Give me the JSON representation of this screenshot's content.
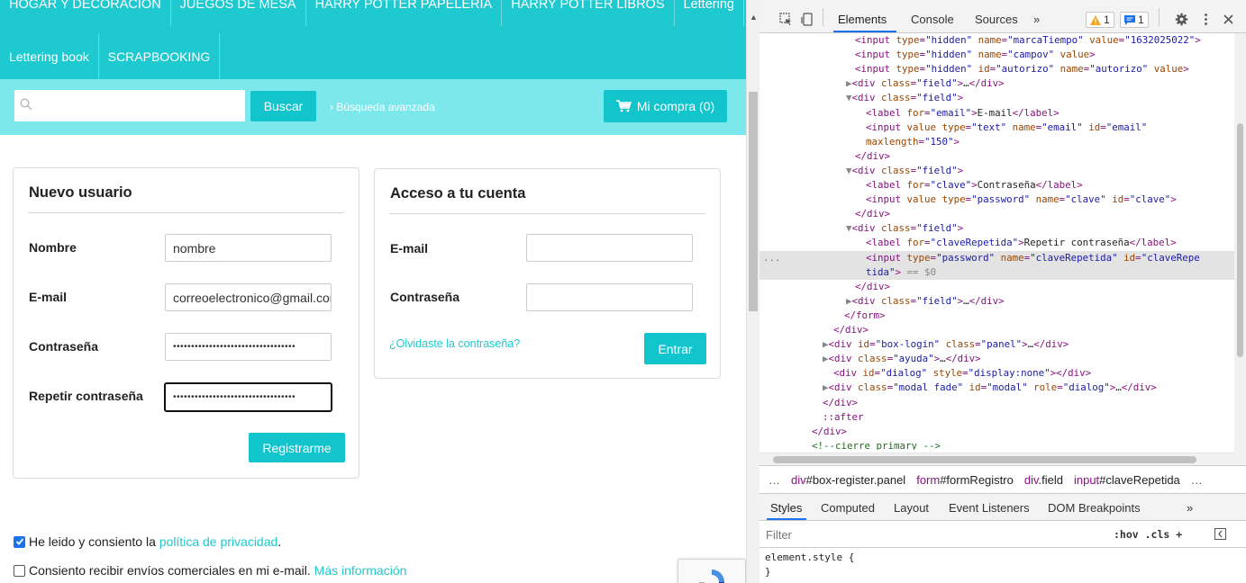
{
  "nav": {
    "row1": [
      "HOGAR Y DECORACIÓN",
      "JUEGOS DE MESA",
      "HARRY POTTER PAPELERÍA",
      "HARRY POTTER LIBROS",
      "Lettering"
    ],
    "row2": [
      "Lettering book",
      "SCRAPBOOKING"
    ]
  },
  "search": {
    "placeholder": "",
    "button_label": "Buscar",
    "advanced_link": "› Búsqueda avanzada",
    "cart_label": "Mi compra (0)"
  },
  "register": {
    "title": "Nuevo usuario",
    "fields": [
      {
        "label": "Nombre",
        "value": "nombre"
      },
      {
        "label": "E-mail",
        "value": "correoelectronico@gmail.com"
      },
      {
        "label": "Contraseña",
        "value": "••••••••••••••••••••••••••••••••••"
      },
      {
        "label": "Repetir contraseña",
        "value": "••••••••••••••••••••••••••••••••••"
      }
    ],
    "submit_label": "Registrarme"
  },
  "login": {
    "title": "Acceso a tu cuenta",
    "email_label": "E-mail",
    "password_label": "Contraseña",
    "forgot_link": "¿Olvidaste la contraseña?",
    "submit_label": "Entrar"
  },
  "consent": {
    "privacy_text": "He leido y consiento la ",
    "privacy_link": "política de privacidad",
    "privacy_suffix": ".",
    "privacy_checked": true,
    "commercial_text": "Consiento recibir envíos comerciales en mi e-mail. ",
    "commercial_link": "Más información",
    "commercial_checked": false
  },
  "devtools": {
    "tabs": [
      "Elements",
      "Console",
      "Sources",
      "»"
    ],
    "warnings_count": "1",
    "messages_count": "1",
    "dom_lines": [
      {
        "indent": 106,
        "html": "<span class='tg'>&lt;input</span> <span class='an'>type</span>=<span class='av'>\"hidden\"</span> <span class='an'>name</span>=<span class='av'>\"marcaTiempo\"</span> <span class='an'>value</span>=<span class='av'>\"1632025022\"</span><span class='tg'>&gt;</span>"
      },
      {
        "indent": 106,
        "html": "<span class='tg'>&lt;input</span> <span class='an'>type</span>=<span class='av'>\"hidden\"</span> <span class='an'>name</span>=<span class='av'>\"campov\"</span> <span class='an'>value</span><span class='tg'>&gt;</span>"
      },
      {
        "indent": 106,
        "html": "<span class='tg'>&lt;input</span> <span class='an'>type</span>=<span class='av'>\"hidden\"</span> <span class='an'>id</span>=<span class='av'>\"autorizo\"</span> <span class='an'>name</span>=<span class='av'>\"autorizo\"</span> <span class='an'>value</span><span class='tg'>&gt;</span>"
      },
      {
        "indent": 96,
        "html": "<span class='gray'>▶</span><span class='tg'>&lt;div</span> <span class='an'>class</span>=<span class='av'>\"field\"</span><span class='tg'>&gt;</span><span class='tx'>…</span><span class='tg'>&lt;/div&gt;</span>"
      },
      {
        "indent": 96,
        "html": "<span class='gray'>▼</span><span class='tg'>&lt;div</span> <span class='an'>class</span>=<span class='av'>\"field\"</span><span class='tg'>&gt;</span>"
      },
      {
        "indent": 118,
        "html": "<span class='tg'>&lt;label</span> <span class='an'>for</span>=<span class='av'>\"email\"</span><span class='tg'>&gt;</span><span class='tx'>E-mail</span><span class='tg'>&lt;/label&gt;</span>"
      },
      {
        "indent": 118,
        "html": "<span class='tg'>&lt;input</span> <span class='an'>value</span> <span class='an'>type</span>=<span class='av'>\"text\"</span> <span class='an'>name</span>=<span class='av'>\"email\"</span> <span class='an'>id</span>=<span class='av'>\"email\"</span>"
      },
      {
        "indent": 118,
        "html": "<span class='an'>maxlength</span>=<span class='av'>\"150\"</span><span class='tg'>&gt;</span>"
      },
      {
        "indent": 106,
        "html": "<span class='tg'>&lt;/div&gt;</span>"
      },
      {
        "indent": 96,
        "html": "<span class='gray'>▼</span><span class='tg'>&lt;div</span> <span class='an'>class</span>=<span class='av'>\"field\"</span><span class='tg'>&gt;</span>"
      },
      {
        "indent": 118,
        "html": "<span class='tg'>&lt;label</span> <span class='an'>for</span>=<span class='av'>\"clave\"</span><span class='tg'>&gt;</span><span class='tx'>Contraseña</span><span class='tg'>&lt;/label&gt;</span>"
      },
      {
        "indent": 118,
        "html": "<span class='tg'>&lt;input</span> <span class='an'>value</span> <span class='an'>type</span>=<span class='av'>\"password\"</span> <span class='an'>name</span>=<span class='av'>\"clave\"</span> <span class='an'>id</span>=<span class='av'>\"clave\"</span><span class='tg'>&gt;</span>"
      },
      {
        "indent": 106,
        "html": "<span class='tg'>&lt;/div&gt;</span>"
      },
      {
        "indent": 96,
        "html": "<span class='gray'>▼</span><span class='tg'>&lt;div</span> <span class='an'>class</span>=<span class='av'>\"field\"</span><span class='tg'>&gt;</span>"
      },
      {
        "indent": 118,
        "html": "<span class='tg'>&lt;label</span> <span class='an'>for</span>=<span class='av'>\"claveRepetida\"</span><span class='tg'>&gt;</span><span class='tx'>Repetir contraseña</span><span class='tg'>&lt;/label&gt;</span>"
      },
      {
        "indent": 118,
        "sel": true,
        "html": "<span class='tg'>&lt;input</span> <span class='an'>type</span>=<span class='av'>\"password\"</span> <span class='an'>name</span>=<span class='av'>\"claveRepetida\"</span> <span class='an'>id</span>=<span class='av'>\"claveRepe</span>"
      },
      {
        "indent": 118,
        "sel": true,
        "html": "<span class='av'>tida\"</span><span class='tg'>&gt;</span> <span class='gray'>== $0</span>"
      },
      {
        "indent": 106,
        "html": "<span class='tg'>&lt;/div&gt;</span>"
      },
      {
        "indent": 96,
        "html": "<span class='gray'>▶</span><span class='tg'>&lt;div</span> <span class='an'>class</span>=<span class='av'>\"field\"</span><span class='tg'>&gt;</span><span class='tx'>…</span><span class='tg'>&lt;/div&gt;</span>"
      },
      {
        "indent": 94,
        "html": "<span class='tg'>&lt;/form&gt;</span>"
      },
      {
        "indent": 82,
        "html": "<span class='tg'>&lt;/div&gt;</span>"
      },
      {
        "indent": 70,
        "html": "<span class='gray'>▶</span><span class='tg'>&lt;div</span> <span class='an'>id</span>=<span class='av'>\"box-login\"</span> <span class='an'>class</span>=<span class='av'>\"panel\"</span><span class='tg'>&gt;</span><span class='tx'>…</span><span class='tg'>&lt;/div&gt;</span>"
      },
      {
        "indent": 70,
        "html": "<span class='gray'>▶</span><span class='tg'>&lt;div</span> <span class='an'>class</span>=<span class='av'>\"ayuda\"</span><span class='tg'>&gt;</span><span class='tx'>…</span><span class='tg'>&lt;/div&gt;</span>"
      },
      {
        "indent": 82,
        "html": "<span class='tg'>&lt;div</span> <span class='an'>id</span>=<span class='av'>\"dialog\"</span> <span class='an'>style</span>=<span class='av'>\"display:none\"</span><span class='tg'>&gt;&lt;/div&gt;</span>"
      },
      {
        "indent": 70,
        "html": "<span class='gray'>▶</span><span class='tg'>&lt;div</span> <span class='an'>class</span>=<span class='av'>\"modal fade\"</span> <span class='an'>id</span>=<span class='av'>\"modal\"</span> <span class='an'>role</span>=<span class='av'>\"dialog\"</span><span class='tg'>&gt;</span><span class='tx'>…</span><span class='tg'>&lt;/div&gt;</span>"
      },
      {
        "indent": 70,
        "html": "<span class='tg'>&lt;/div&gt;</span>"
      },
      {
        "indent": 70,
        "html": "<span class='pseudo'>::after</span>"
      },
      {
        "indent": 58,
        "html": "<span class='tg'>&lt;/div&gt;</span>"
      },
      {
        "indent": 58,
        "html": "<span class='cm'>&lt;!--cierre primary --&gt;</span>"
      }
    ],
    "breadcrumbs": [
      {
        "tag": "…",
        "cls": ""
      },
      {
        "tag": "div",
        "cls": "#box-register.panel"
      },
      {
        "tag": "form",
        "cls": "#formRegistro"
      },
      {
        "tag": "div",
        "cls": ".field"
      },
      {
        "tag": "input",
        "cls": "#claveRepetida"
      },
      {
        "tag": "…",
        "cls": ""
      }
    ],
    "styles_tabs": [
      "Styles",
      "Computed",
      "Layout",
      "Event Listeners",
      "DOM Breakpoints",
      "»"
    ],
    "filter_placeholder": "Filter",
    "hov_cls": ":hov  .cls  +",
    "style_rule": "element.style {",
    "style_close": "}"
  }
}
